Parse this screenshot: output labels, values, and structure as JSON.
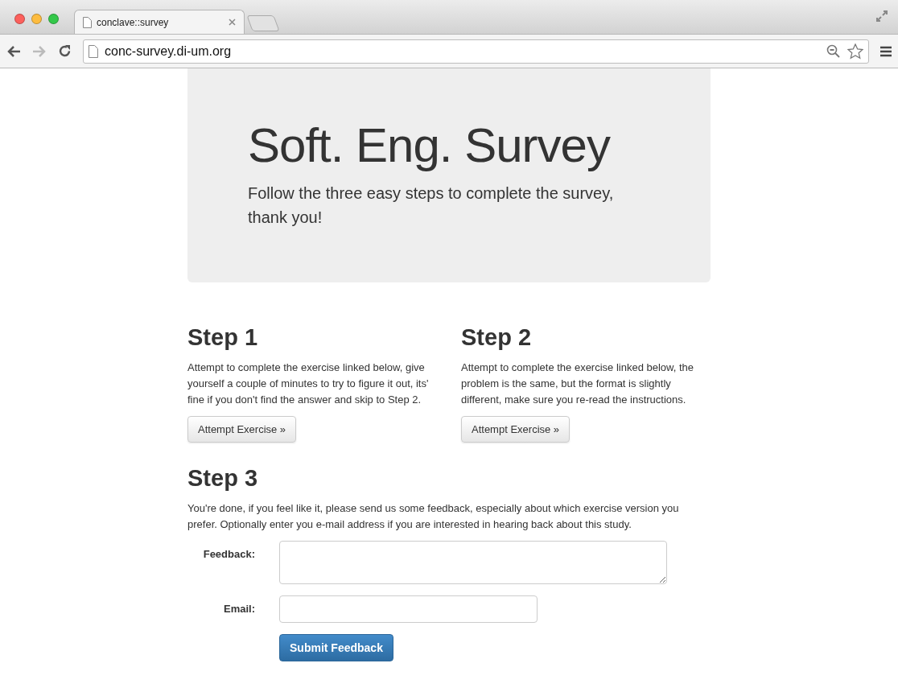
{
  "browser": {
    "tab_title": "conclave::survey",
    "address": "conc-survey.di-um.org"
  },
  "hero": {
    "title": "Soft. Eng. Survey",
    "subtitle": "Follow the three easy steps to complete the survey, thank you!"
  },
  "steps": [
    {
      "title": "Step 1",
      "text": "Attempt to complete the exercise linked below, give yourself a couple of minutes to try to figure it out, its' fine if you don't find the answer and skip to Step 2.",
      "button": "Attempt Exercise »"
    },
    {
      "title": "Step 2",
      "text": "Attempt to complete the exercise linked below, the problem is the same, but the format is slightly different, make sure you re-read the instructions.",
      "button": "Attempt Exercise »"
    }
  ],
  "step3": {
    "title": "Step 3",
    "text": "You're done, if you feel like it, please send us some feedback, especially about which exercise version you prefer. Optionally enter you e-mail address if you are interested in hearing back about this study.",
    "feedback_label": "Feedback:",
    "email_label": "Email:",
    "submit": "Submit Feedback"
  }
}
